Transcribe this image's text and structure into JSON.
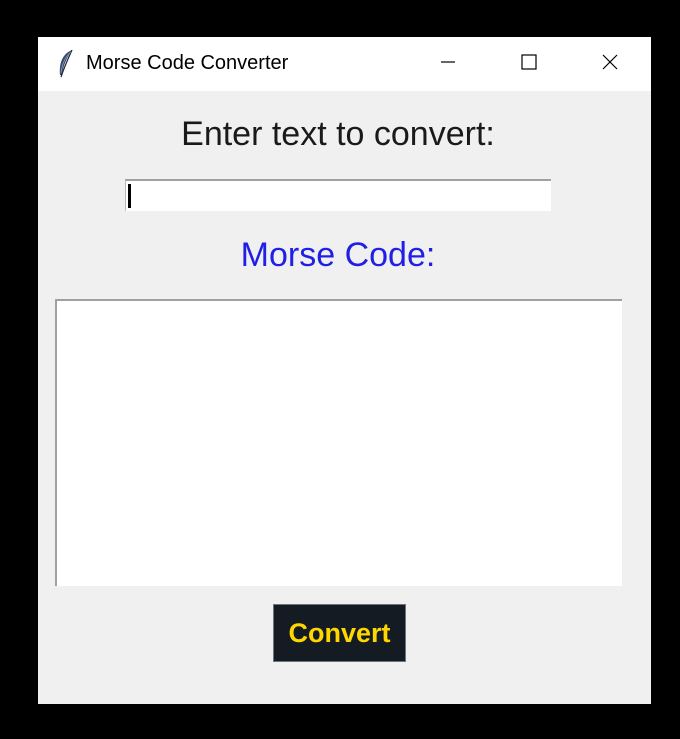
{
  "window": {
    "title": "Morse Code Converter",
    "icon": "feather-icon",
    "controls": [
      "minimize-icon",
      "maximize-icon",
      "close-icon"
    ]
  },
  "input": {
    "label": "Enter text to convert:",
    "value": ""
  },
  "output": {
    "label": "Morse Code:",
    "value": ""
  },
  "actions": {
    "convert_label": "Convert"
  },
  "colors": {
    "window_background": "#f0f0f0",
    "morse_label": "#1f1fe6",
    "button_background": "#141b22",
    "button_text": "#ffd700"
  }
}
